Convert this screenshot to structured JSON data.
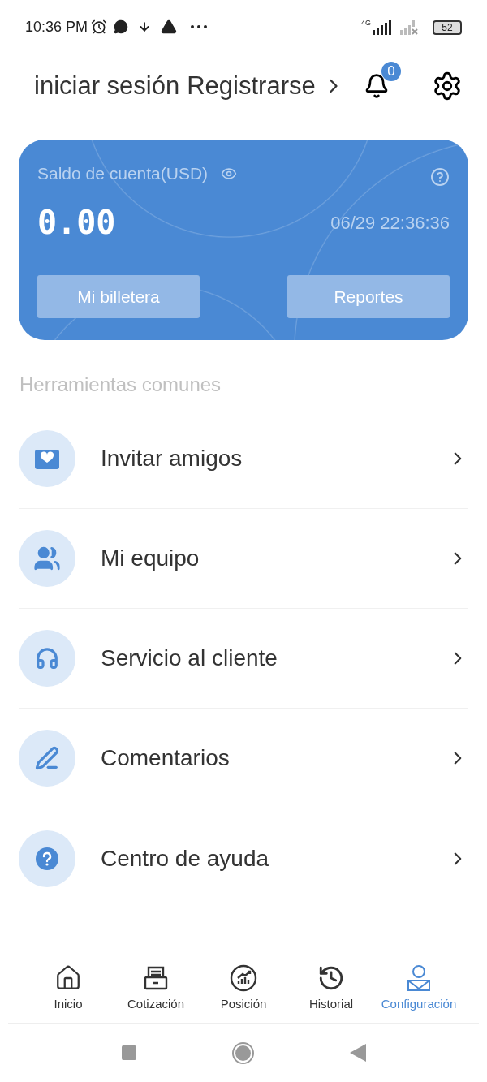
{
  "status_bar": {
    "time": "10:36 PM",
    "network": "4G",
    "battery": "52"
  },
  "header": {
    "login": "iniciar sesión",
    "register": "Registrarse",
    "notification_count": "0"
  },
  "balance_card": {
    "label": "Saldo de cuenta(USD)",
    "amount": "0.00",
    "timestamp": "06/29 22:36:36",
    "buttons": [
      "Mi billetera",
      "Reportes"
    ]
  },
  "section_title": "Herramientas comunes",
  "tools": [
    {
      "label": "Invitar amigos",
      "kind": "invite"
    },
    {
      "label": "Mi equipo",
      "kind": "team"
    },
    {
      "label": "Servicio al cliente",
      "kind": "support"
    },
    {
      "label": "Comentarios",
      "kind": "feedback"
    },
    {
      "label": "Centro de ayuda",
      "kind": "help"
    }
  ],
  "bottom_nav": [
    {
      "label": "Inicio",
      "kind": "home",
      "selected": false
    },
    {
      "label": "Cotización",
      "kind": "quote",
      "selected": false
    },
    {
      "label": "Posición",
      "kind": "position",
      "selected": false
    },
    {
      "label": "Historial",
      "kind": "history",
      "selected": false
    },
    {
      "label": "Configuración",
      "kind": "profile",
      "selected": true
    }
  ]
}
